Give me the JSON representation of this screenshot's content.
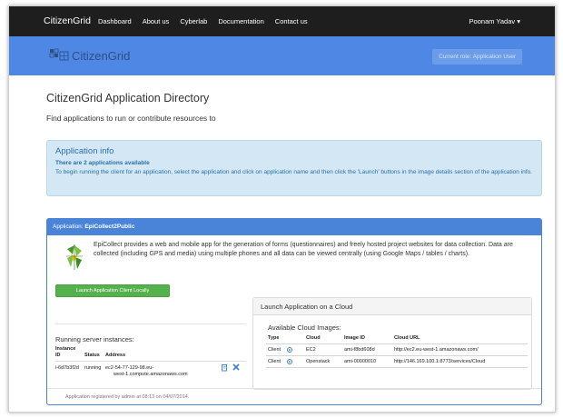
{
  "navbar": {
    "brand": "CitizenGrid",
    "links": [
      "Dashboard",
      "About us",
      "Cyberlab",
      "Documentation",
      "Contact us"
    ],
    "user": "Poonam Yadav",
    "user_caret": "▾"
  },
  "header": {
    "logo_text": "CitizenGrid",
    "role_badge": "Current role: Application User"
  },
  "page": {
    "title": "CitizenGrid Application Directory",
    "subtitle": "Find applications to run or contribute resources to"
  },
  "info": {
    "title": "Application info",
    "count_text": "There are 2 applications available",
    "instructions": "To begin running the client for an application, select the application and click on application name and then click the 'Launch' buttons in the image details section of the application info."
  },
  "application": {
    "heading_prefix": "Application:",
    "name": "EpiCollect2Public",
    "description": "EpiCollect provides a web and mobile app for the generation of forms (questionnaires) and freely hosted project websites for data collection. Data are collected (including GPS and media) using multiple phones and all data can be viewed centrally (using Google Maps / tables / charts).",
    "launch_local_label": "Launch Application Client Locally",
    "footer": "Application registered by admin at 08:13 on 04/07/2014."
  },
  "running": {
    "title": "Running server instances:",
    "headers": {
      "instance_id_1": "Instance",
      "instance_id_2": "ID",
      "status": "Status",
      "address": "Address"
    },
    "rows": [
      {
        "id": "i-6d7b3f2d",
        "status": "running",
        "address_1": "ec2-54-77-129-98.eu-",
        "address_2": "west-1.compute.amazonaws.com"
      }
    ],
    "icons": {
      "copy": "copy-icon",
      "delete": "close-icon"
    }
  },
  "cloud": {
    "heading": "Launch Application on a Cloud",
    "available_title": "Available Cloud Images:",
    "headers": {
      "type": "Type",
      "cloud": "Cloud",
      "image_id": "Image ID",
      "cloud_url": "Cloud URL"
    },
    "rows": [
      {
        "type": "Client",
        "cloud": "EC2",
        "image_id": "ami-f8bd608d",
        "url": "http://ec2.eu-west-1.amazonaws.com/"
      },
      {
        "type": "Client",
        "cloud": "Openstack",
        "image_id": "ami-00000010",
        "url": "http://146.169.100.1:8773/services/Cloud"
      }
    ]
  },
  "colors": {
    "navbar": "#1e1e1e",
    "header": "#4f87e5",
    "panel": "#4a84d8",
    "info_bg": "#d3e8f4",
    "launch_button": "#55b14c"
  }
}
